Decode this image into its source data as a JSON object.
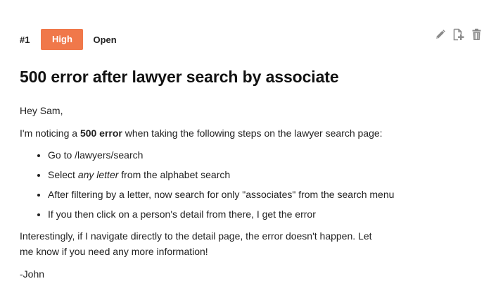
{
  "issue": {
    "number": "#1",
    "priority": "High",
    "status": "Open",
    "title": "500 error after lawyer search by associate"
  },
  "actions": [
    {
      "name": "edit",
      "icon": "pencil-icon"
    },
    {
      "name": "add-page",
      "icon": "add-page-icon"
    },
    {
      "name": "delete",
      "icon": "trash-icon"
    }
  ],
  "body": {
    "greeting": "Hey Sam,",
    "intro_before": "I'm noticing a ",
    "intro_bold": "500 error",
    "intro_after": " when taking the following steps on the lawyer search page:",
    "steps": {
      "s1": "Go to /lawyers/search",
      "s2_before": "Select ",
      "s2_italic": "any letter",
      "s2_after": " from the alphabet search",
      "s3": "After filtering by a letter, now search for only \"associates\" from the search menu",
      "s4": "If you then click on a person's detail from there, I get the error"
    },
    "closing": "Interestingly, if I navigate directly to the detail page, the error doesn't happen. Let me know if you need any more information!",
    "signature": "-John"
  },
  "colors": {
    "priority_badge": "#f0784a",
    "icon_gray": "#8a8a8a",
    "text": "#222222"
  }
}
